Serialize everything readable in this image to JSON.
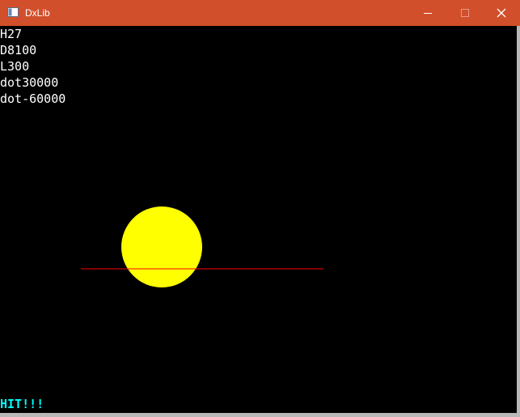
{
  "window": {
    "title": "DxLib",
    "titlebar_color": "#d24f2b",
    "icons": {
      "app": "window-app-icon",
      "minimize": "minimize-icon",
      "maximize": "maximize-icon",
      "close": "close-icon"
    }
  },
  "canvas": {
    "background": "#000000",
    "debug_lines": [
      {
        "name": "height-readout",
        "text": "H27"
      },
      {
        "name": "distance-readout",
        "text": "D8100"
      },
      {
        "name": "length-readout",
        "text": "L300"
      },
      {
        "name": "dot-product-1",
        "text": "dot30000"
      },
      {
        "name": "dot-product-2",
        "text": "dot-60000"
      }
    ],
    "status": {
      "text": "HIT!!!",
      "color": "#00ffff"
    },
    "circle_color": "#ffff00",
    "line_color": "#ff0000"
  }
}
